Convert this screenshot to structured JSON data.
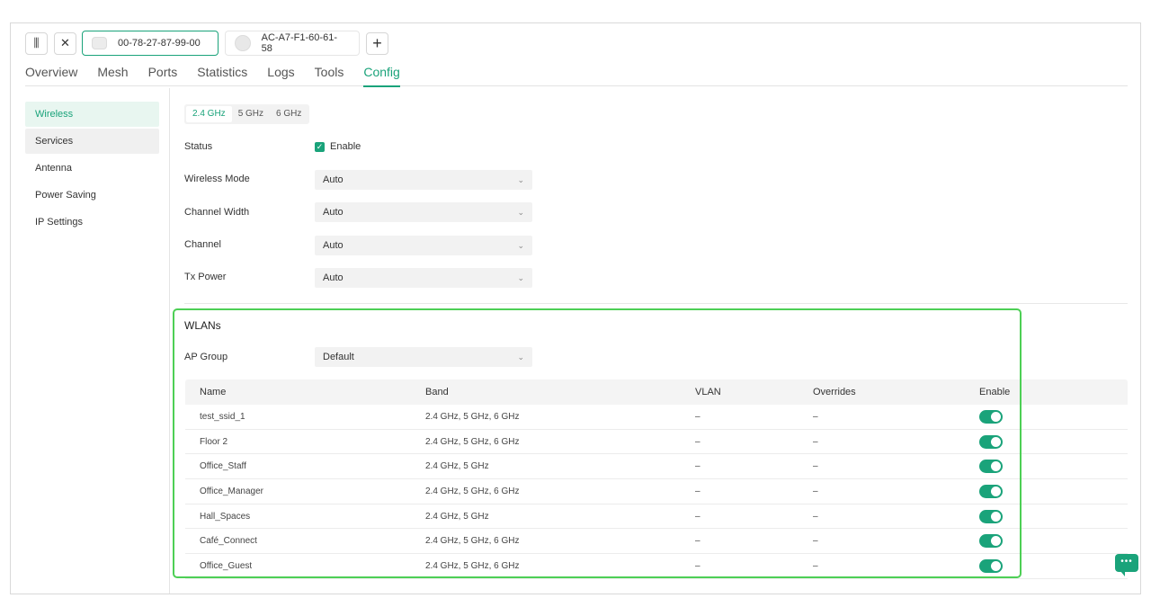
{
  "topbar": {
    "collapse_icon": "collapse-sidebar-icon",
    "close_icon": "close-icon",
    "devices": [
      {
        "name": "00-78-27-87-99-00",
        "active": true
      },
      {
        "name": "AC-A7-F1-60-61-58",
        "active": false
      }
    ],
    "add_icon": "plus-icon",
    "add_symbol": "+",
    "close_symbol": "✕",
    "collapse_symbol": "⫼"
  },
  "tabs": [
    "Overview",
    "Mesh",
    "Ports",
    "Statistics",
    "Logs",
    "Tools",
    "Config"
  ],
  "active_tab": "Config",
  "sidebar": {
    "items": [
      "Wireless",
      "Services",
      "Antenna",
      "Power Saving",
      "IP Settings"
    ],
    "active": "Wireless"
  },
  "bands": [
    "2.4 GHz",
    "5 GHz",
    "6 GHz"
  ],
  "active_band": "2.4 GHz",
  "form": {
    "status_label": "Status",
    "enable_label": "Enable",
    "enabled": true,
    "fields": [
      {
        "label": "Wireless Mode",
        "value": "Auto"
      },
      {
        "label": "Channel Width",
        "value": "Auto"
      },
      {
        "label": "Channel",
        "value": "Auto"
      },
      {
        "label": "Tx Power",
        "value": "Auto"
      }
    ]
  },
  "wlans": {
    "title": "WLANs",
    "ap_group_label": "AP Group",
    "ap_group_value": "Default",
    "columns": [
      "Name",
      "Band",
      "VLAN",
      "Overrides",
      "Enable"
    ],
    "rows": [
      {
        "name": "test_ssid_1",
        "band": "2.4 GHz, 5 GHz, 6 GHz",
        "vlan": "–",
        "overrides": "–",
        "enabled": true
      },
      {
        "name": "Floor 2",
        "band": "2.4 GHz, 5 GHz, 6 GHz",
        "vlan": "–",
        "overrides": "–",
        "enabled": true
      },
      {
        "name": "Office_Staff",
        "band": "2.4 GHz, 5 GHz",
        "vlan": "–",
        "overrides": "–",
        "enabled": true
      },
      {
        "name": "Office_Manager",
        "band": "2.4 GHz, 5 GHz, 6 GHz",
        "vlan": "–",
        "overrides": "–",
        "enabled": true
      },
      {
        "name": "Hall_Spaces",
        "band": "2.4 GHz, 5 GHz",
        "vlan": "–",
        "overrides": "–",
        "enabled": true
      },
      {
        "name": "Café_Connect",
        "band": "2.4 GHz, 5 GHz, 6 GHz",
        "vlan": "–",
        "overrides": "–",
        "enabled": true
      },
      {
        "name": "Office_Guest",
        "band": "2.4 GHz, 5 GHz, 6 GHz",
        "vlan": "–",
        "overrides": "–",
        "enabled": true
      }
    ]
  },
  "chat_icon": "chat-bubble-icon",
  "colors": {
    "accent": "#1aa37a",
    "highlight_box": "#4dcf55"
  }
}
